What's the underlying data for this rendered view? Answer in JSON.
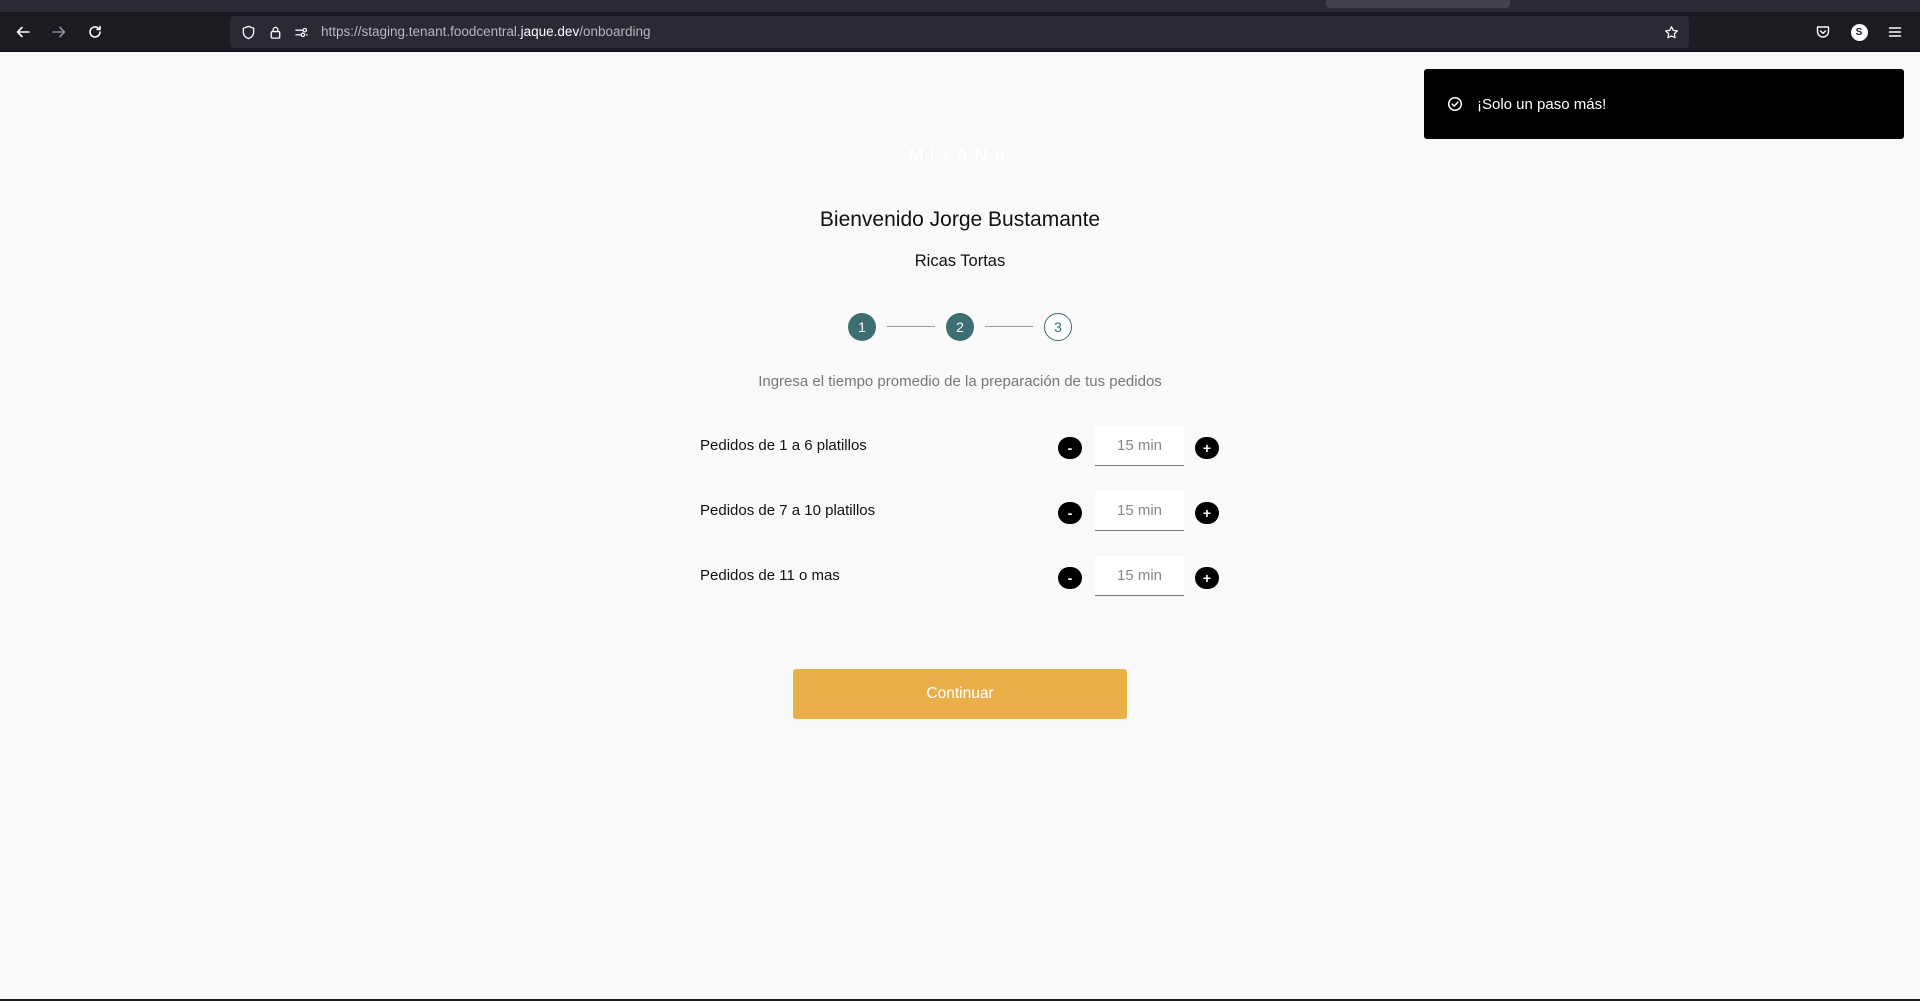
{
  "browser": {
    "url_prefix": "https://staging.tenant.foodcentral.",
    "url_host": "jaque.dev",
    "url_path": "/onboarding",
    "profile_initial": "S"
  },
  "toast": {
    "message": "¡Solo un paso más!"
  },
  "brand": {
    "logo_text": "MIYANA"
  },
  "header": {
    "welcome": "Bienvenido Jorge Bustamante",
    "tenant_name": "Ricas Tortas"
  },
  "stepper": {
    "steps": [
      "1",
      "2",
      "3"
    ],
    "current_step": 2
  },
  "form": {
    "instructions": "Ingresa el tiempo promedio de la preparación de tus pedidos",
    "decrement_label": "-",
    "increment_label": "+",
    "rows": [
      {
        "label": "Pedidos de 1 a 6 platillos",
        "value": "15 min"
      },
      {
        "label": "Pedidos de 7 a 10 platillos",
        "value": "15 min"
      },
      {
        "label": "Pedidos de 11 o mas",
        "value": "15 min"
      }
    ],
    "continue_label": "Continuar"
  },
  "colors": {
    "accent_button": "#ebaf4a",
    "step_color": "#3d6e72",
    "toast_bg": "#000000"
  }
}
